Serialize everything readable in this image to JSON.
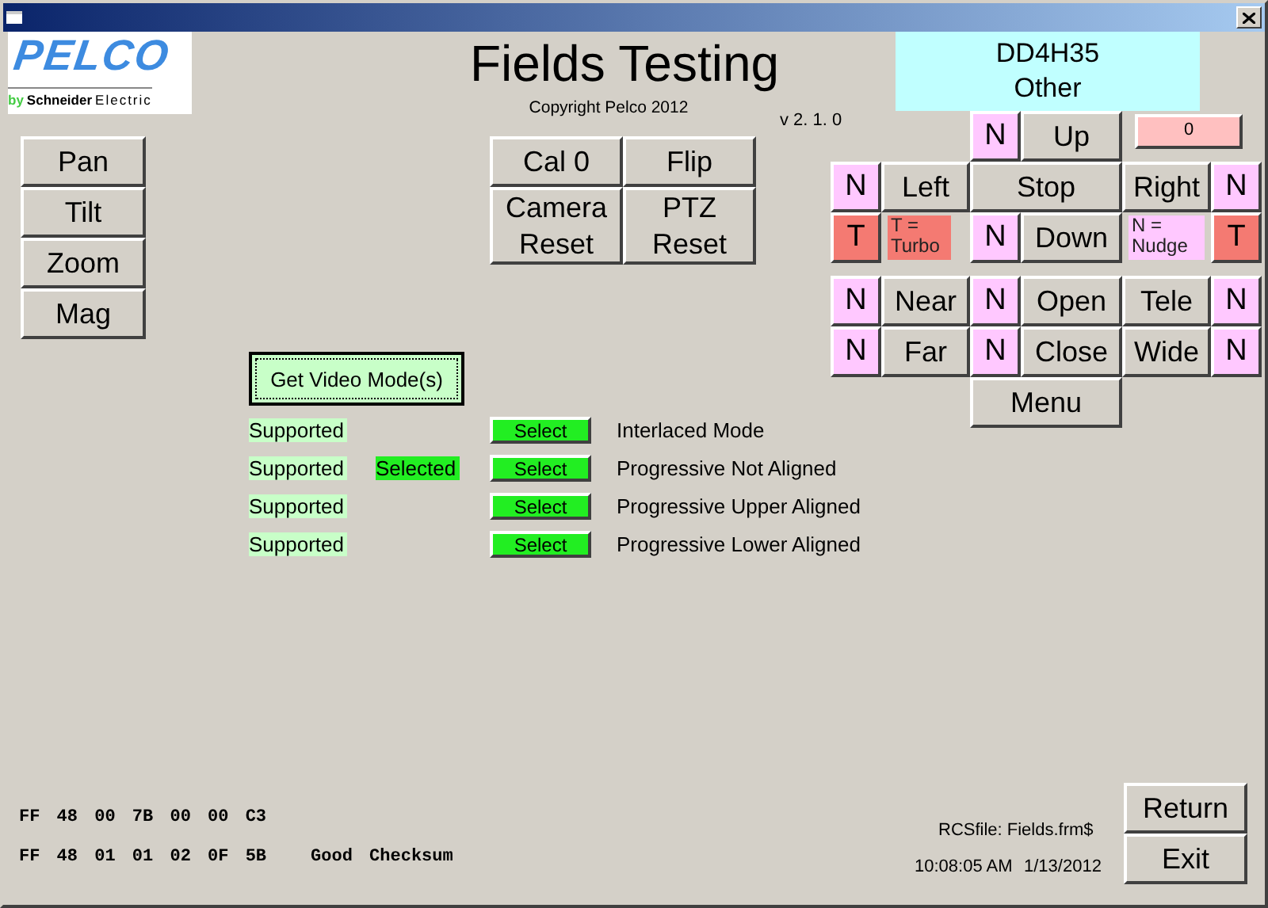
{
  "logo": {
    "brand": "PELCO",
    "by": "by",
    "company": "Schneider",
    "suffix": "Electric"
  },
  "title": "Fields Testing",
  "copyright": "Copyright Pelco 2012",
  "version": "v 2. 1. 0",
  "device": {
    "model": "DD4H35",
    "type": "Other"
  },
  "mode_buttons": [
    "Pan",
    "Tilt",
    "Zoom",
    "Mag"
  ],
  "action_buttons": [
    "Cal 0",
    "Flip",
    "Camera\nReset",
    "PTZ\nReset"
  ],
  "pad": [
    [
      {
        "kind": "blank"
      },
      {
        "kind": "blank"
      },
      {
        "kind": "nudge",
        "label": "N"
      },
      {
        "kind": "button",
        "label": "Up"
      },
      {
        "kind": "counter",
        "label": "0"
      }
    ],
    [
      {
        "kind": "nudge",
        "label": "N"
      },
      {
        "kind": "button",
        "label": "Left"
      },
      {
        "kind": "wide",
        "label": "Stop"
      },
      {
        "kind": "button",
        "label": "Right"
      },
      {
        "kind": "nudge",
        "label": "N"
      }
    ],
    [
      {
        "kind": "turbo",
        "label": "T"
      },
      {
        "kind": "legend_turbo",
        "label": "T =\nTurbo"
      },
      {
        "kind": "nudge",
        "label": "N"
      },
      {
        "kind": "button",
        "label": "Down"
      },
      {
        "kind": "legend_nudge",
        "label": "N =\nNudge"
      },
      {
        "kind": "turbo",
        "label": "T"
      }
    ],
    [
      {
        "kind": "spacer"
      }
    ],
    [
      {
        "kind": "nudge",
        "label": "N"
      },
      {
        "kind": "button",
        "label": "Near"
      },
      {
        "kind": "nudge",
        "label": "N"
      },
      {
        "kind": "button",
        "label": "Open"
      },
      {
        "kind": "button",
        "label": "Tele"
      },
      {
        "kind": "nudge",
        "label": "N"
      }
    ],
    [
      {
        "kind": "nudge",
        "label": "N"
      },
      {
        "kind": "button",
        "label": "Far"
      },
      {
        "kind": "nudge",
        "label": "N"
      },
      {
        "kind": "button",
        "label": "Close"
      },
      {
        "kind": "button",
        "label": "Wide"
      },
      {
        "kind": "nudge",
        "label": "N"
      }
    ],
    [
      {
        "kind": "blank"
      },
      {
        "kind": "blank"
      },
      {
        "kind": "wide",
        "label": "Menu"
      }
    ]
  ],
  "video": {
    "button": "Get Video Mode(s)",
    "selected_text": "Selected",
    "modes": [
      {
        "status": "Supported",
        "selected": false,
        "action": "Select",
        "name": "Interlaced Mode"
      },
      {
        "status": "Supported",
        "selected": true,
        "action": "Select",
        "name": "Progressive Not Aligned"
      },
      {
        "status": "Supported",
        "selected": false,
        "action": "Select",
        "name": "Progressive Upper Aligned"
      },
      {
        "status": "Supported",
        "selected": false,
        "action": "Select",
        "name": "Progressive Lower Aligned"
      }
    ]
  },
  "status": {
    "packets": [
      "FF 48 00 7B 00 00 C3",
      "FF 48 01 01 02 0F 5B"
    ],
    "checksum": "Good Checksum",
    "rcs_file": "RCSfile: Fields.frm$",
    "time": "10:08:05 AM",
    "date": "1/13/2012"
  },
  "nav_buttons": [
    "Return",
    "Exit"
  ]
}
